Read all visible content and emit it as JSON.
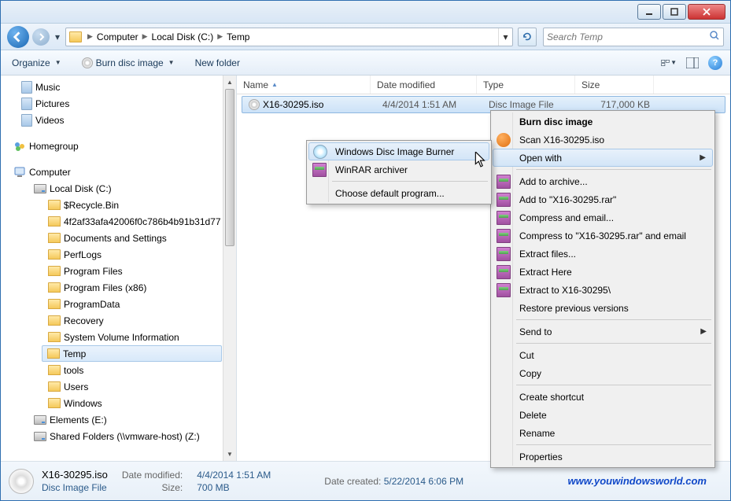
{
  "breadcrumbs": [
    "Computer",
    "Local Disk (C:)",
    "Temp"
  ],
  "search": {
    "placeholder": "Search Temp"
  },
  "toolbar": {
    "organize": "Organize",
    "burn": "Burn disc image",
    "newfolder": "New folder"
  },
  "sidebar": {
    "libs": [
      "Music",
      "Pictures",
      "Videos"
    ],
    "homegroup": "Homegroup",
    "computer": "Computer",
    "drive_c": "Local Disk (C:)",
    "c_folders": [
      "$Recycle.Bin",
      "4f2af33afa42006f0c786b4b91b31d77",
      "Documents and Settings",
      "PerfLogs",
      "Program Files",
      "Program Files (x86)",
      "ProgramData",
      "Recovery",
      "System Volume Information",
      "Temp",
      "tools",
      "Users",
      "Windows"
    ],
    "drive_e": "Elements (E:)",
    "drive_z": "Shared Folders (\\\\vmware-host) (Z:)"
  },
  "columns": {
    "name": "Name",
    "date": "Date modified",
    "type": "Type",
    "size": "Size"
  },
  "file": {
    "name": "X16-30295.iso",
    "date": "4/4/2014 1:51 AM",
    "type": "Disc Image File",
    "size": "717,000 KB"
  },
  "status": {
    "filename": "X16-30295.iso",
    "modified_label": "Date modified:",
    "modified": "4/4/2014 1:51 AM",
    "typeline": "Disc Image File",
    "size_label": "Size:",
    "size": "700 MB",
    "created_label": "Date created:",
    "created": "5/22/2014 6:06 PM"
  },
  "watermark": "www.youwindowsworld.com",
  "context_main": {
    "burn": "Burn disc image",
    "scan": "Scan X16-30295.iso",
    "openwith": "Open with",
    "addarchive": "Add to archive...",
    "addrar": "Add to \"X16-30295.rar\"",
    "compressmail": "Compress and email...",
    "compressrarmail": "Compress to \"X16-30295.rar\" and email",
    "extractfiles": "Extract files...",
    "extracthere": "Extract Here",
    "extractto": "Extract to X16-30295\\",
    "restore": "Restore previous versions",
    "sendto": "Send to",
    "cut": "Cut",
    "copy": "Copy",
    "shortcut": "Create shortcut",
    "delete": "Delete",
    "rename": "Rename",
    "properties": "Properties"
  },
  "context_sub": {
    "burner": "Windows Disc Image Burner",
    "winrar": "WinRAR archiver",
    "choose": "Choose default program..."
  }
}
